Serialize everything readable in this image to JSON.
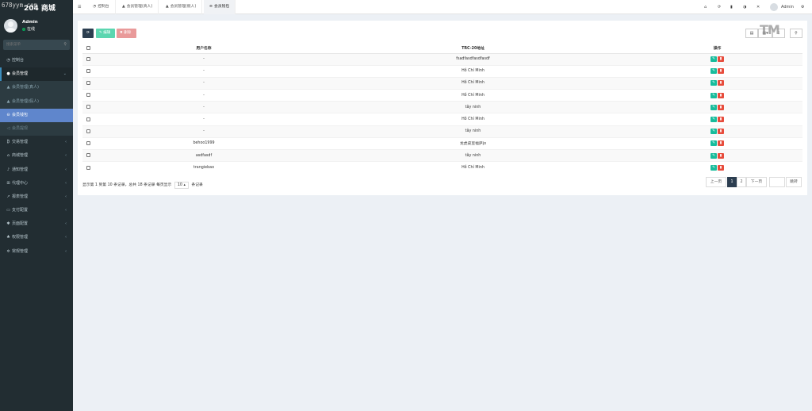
{
  "brand": {
    "watermark": "678yym.com",
    "title": "204 商城"
  },
  "user": {
    "name": "Admin",
    "status": "在线"
  },
  "sidebar_search": {
    "placeholder": "搜索菜单"
  },
  "menu": [
    {
      "label": "控制台",
      "icon": "dashboard-icon",
      "icon_glyph": "◔"
    },
    {
      "label": "会员管理",
      "icon": "user-icon",
      "icon_glyph": "●",
      "open": true
    },
    {
      "label": "会员管理(真人)",
      "icon": "user-icon",
      "icon_glyph": "▲",
      "sub": true
    },
    {
      "label": "会员管理(假人)",
      "icon": "user-icon",
      "icon_glyph": "▲",
      "sub": true
    },
    {
      "label": "会员钱包",
      "icon": "wallet-icon",
      "icon_glyph": "⊖",
      "active": true
    },
    {
      "label": "会员提现",
      "icon": "volume-icon",
      "icon_glyph": "◁",
      "sub": true
    },
    {
      "label": "交易管理",
      "icon": "bitcoin-icon",
      "icon_glyph": "₿"
    },
    {
      "label": "商城管理",
      "icon": "home-icon",
      "icon_glyph": "⌂"
    },
    {
      "label": "通知管理",
      "icon": "bell-icon",
      "icon_glyph": "♪"
    },
    {
      "label": "代理中心",
      "icon": "sitemap-icon",
      "icon_glyph": "⊞"
    },
    {
      "label": "报表管理",
      "icon": "chart-icon",
      "icon_glyph": "↗"
    },
    {
      "label": "支付配置",
      "icon": "card-icon",
      "icon_glyph": "▭"
    },
    {
      "label": "页面配置",
      "icon": "gear-icon",
      "icon_glyph": "✱"
    },
    {
      "label": "权限管理",
      "icon": "group-icon",
      "icon_glyph": "♣"
    },
    {
      "label": "常规管理",
      "icon": "cogs-icon",
      "icon_glyph": "✲"
    }
  ],
  "tabs": [
    {
      "label": "控制台",
      "icon": "dashboard-icon",
      "icon_glyph": "◔"
    },
    {
      "label": "会员管理(真人)",
      "icon": "user-icon",
      "icon_glyph": "▲"
    },
    {
      "label": "会员管理(假人)",
      "icon": "user-icon",
      "icon_glyph": "▲"
    },
    {
      "label": "会员钱包",
      "icon": "wallet-icon",
      "icon_glyph": "⊖",
      "active": true
    }
  ],
  "header": {
    "admin_label": "Admin"
  },
  "toolbar": {
    "edit_label": "✎ 编辑",
    "delete_label": "✖ 删除",
    "tm_mark": "TM"
  },
  "table": {
    "headers": [
      "用户名称",
      "TRC-20地址",
      "操作"
    ],
    "rows": [
      {
        "username": "-",
        "address": "fsadfasdfasdfasdf"
      },
      {
        "username": "-",
        "address": "Hồ Chí Minh"
      },
      {
        "username": "-",
        "address": "Hồ Chí Minh"
      },
      {
        "username": "-",
        "address": "Hồ Chí Minh"
      },
      {
        "username": "-",
        "address": "tây ninh"
      },
      {
        "username": "-",
        "address": "Hồ Chí Minh"
      },
      {
        "username": "-",
        "address": "tây ninh"
      },
      {
        "username": "behoo1999",
        "address": "龙虎皮豆福萨jo"
      },
      {
        "username": "asdfasdf",
        "address": "tây ninh"
      },
      {
        "username": "trangiebao",
        "address": "Hồ Chí Minh"
      }
    ]
  },
  "pagination": {
    "info_prefix": "显示第 1 到第 10 条记录，总共 18 条记录 每页显示",
    "page_size": "10 ▴",
    "info_suffix": "条记录",
    "prev": "上一页",
    "pages": [
      "1",
      "2"
    ],
    "current_page": "1",
    "next": "下一页",
    "goto_label": "跳转"
  },
  "colors": {
    "sidebar_bg": "#222d32",
    "active_menu": "#5f86cc",
    "edit_green": "#18bc9c",
    "delete_red": "#e74c3c",
    "primary_dark": "#2c3e50"
  }
}
